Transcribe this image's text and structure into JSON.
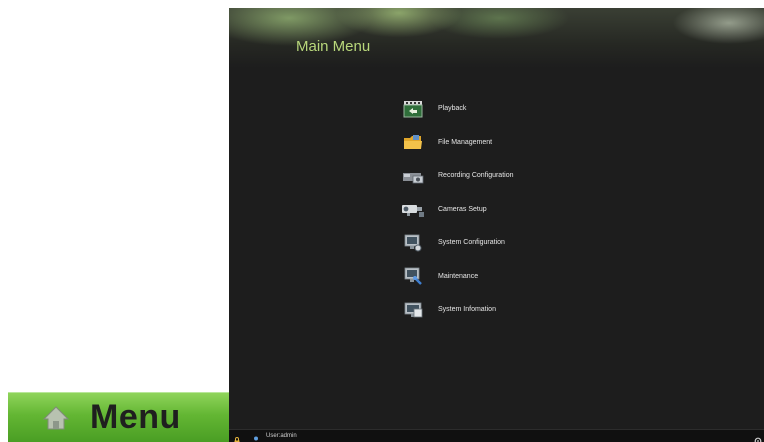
{
  "side_tab": {
    "icon": "home-icon",
    "label": "Menu",
    "color": "#63b633"
  },
  "screen": {
    "title": "Main Menu",
    "title_color": "#b8d77b",
    "background": "#1d1d1d",
    "menu_items": [
      {
        "label": "Playback",
        "icon": "playback-icon"
      },
      {
        "label": "File Management",
        "icon": "folder-icon"
      },
      {
        "label": "Recording Configuration",
        "icon": "recorder-icon"
      },
      {
        "label": "Cameras Setup",
        "icon": "camera-icon"
      },
      {
        "label": "System Configuration",
        "icon": "system-config-icon"
      },
      {
        "label": "Maintenance",
        "icon": "maintenance-icon"
      },
      {
        "label": "System Infomation",
        "icon": "system-info-icon"
      }
    ],
    "status": {
      "user_text": "User:admin"
    }
  }
}
